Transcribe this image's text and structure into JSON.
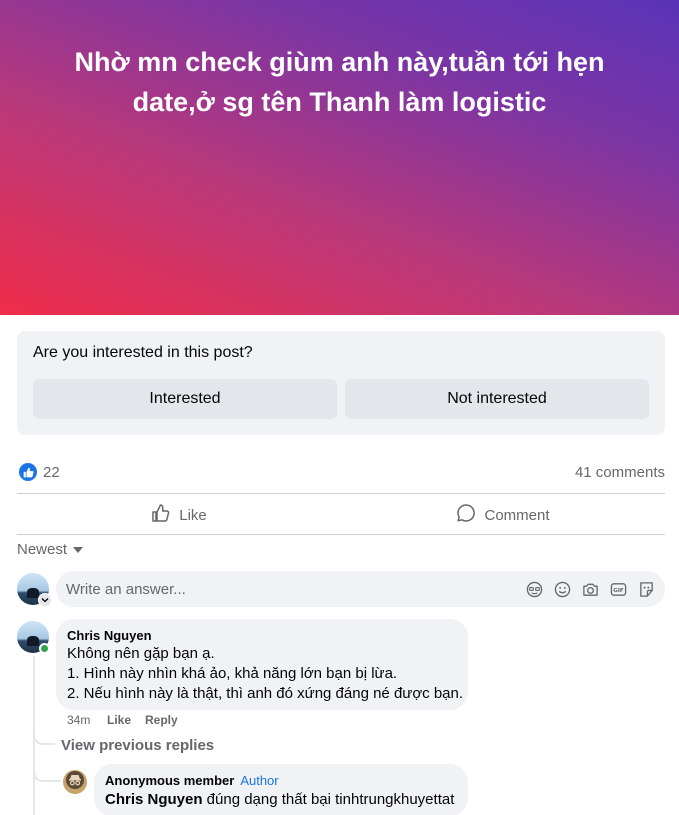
{
  "banner": {
    "title": "Nhờ mn check giùm anh này,tuần tới hẹn date,ở sg tên Thanh làm logistic"
  },
  "interest_prompt": {
    "question": "Are you interested in this post?",
    "interested_label": "Interested",
    "not_interested_label": "Not interested"
  },
  "stats": {
    "like_count": "22",
    "comments_count": "41 comments"
  },
  "actions": {
    "like_label": "Like",
    "comment_label": "Comment"
  },
  "sort": {
    "label": "Newest"
  },
  "answer": {
    "placeholder": "Write an answer...",
    "tools": [
      "avatar-sticker-icon",
      "emoji-icon",
      "camera-icon",
      "gif-icon",
      "sticker-icon"
    ]
  },
  "comments": [
    {
      "author": "Chris Nguyen",
      "lines": [
        "Không nên gặp bạn ạ.",
        "1. Hình này nhìn khá ảo, khả năng lớn bạn bị lừa.",
        "2. Nếu hình này là thật, thì anh đó xứng đáng né được bạn."
      ],
      "time": "34m",
      "like_label": "Like",
      "reply_label": "Reply"
    }
  ],
  "view_previous": "View previous replies",
  "reply": {
    "author": "Anonymous member",
    "badge": "Author",
    "mention": "Chris Nguyen",
    "text": " đúng dạng thất bại tinhtrungkhuyettat"
  },
  "colors": {
    "accent": "#1b74e4",
    "online": "#31a24c",
    "banner_start": "#f02d4a",
    "banner_end": "#5a33b8"
  }
}
